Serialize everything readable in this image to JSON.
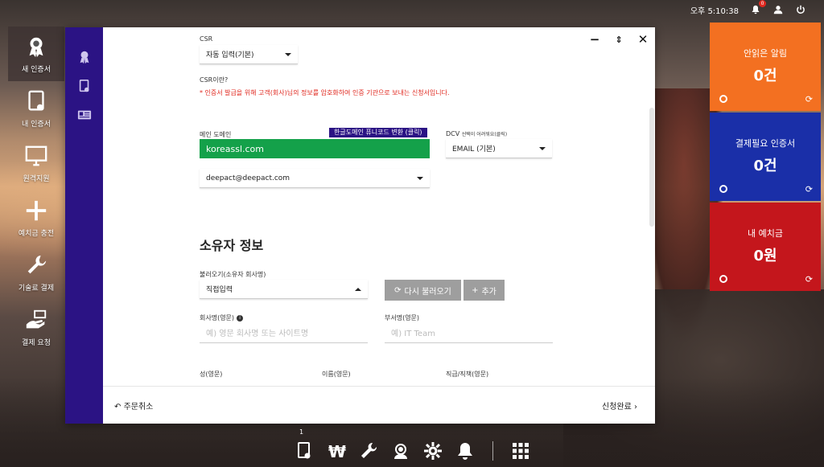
{
  "topbar": {
    "time": "오후 5:10:38",
    "notif_count": "0"
  },
  "desktop": [
    {
      "label": "새 인증서",
      "icon": "award-icon",
      "active": true
    },
    {
      "label": "내 인증서",
      "icon": "certificate-icon"
    },
    {
      "label": "원격지원",
      "icon": "monitor-icon"
    },
    {
      "label": "예치금 충전",
      "icon": "plus-icon"
    },
    {
      "label": "기술료 결제",
      "icon": "wrench-icon"
    },
    {
      "label": "결제 요청",
      "icon": "payment-icon"
    }
  ],
  "form": {
    "csr_label": "CSR",
    "csr_select": "자동 입력(기본)",
    "csr_what": "CSR이란?",
    "csr_note": "* 인증서 발급을 위해 고객(회사)님의 정보를 암호화하여 인증 기관으로 보내는 신청서입니다.",
    "main_domain_label": "메인 도메인",
    "punycode_btn": "한글도메인 퓨니코드 변환 (클릭)",
    "domain_value": "koreassl.com",
    "dcv_label": "DCV",
    "dcv_hint": "선택이 어려워요(클릭)",
    "dcv_select": "EMAIL (기본)",
    "email_select": "deepact@deepact.com",
    "owner_title": "소유자 정보",
    "load_label": "불러오기(소유자 회사명)",
    "load_select": "직접입력",
    "reload_btn": "다시 불러오기",
    "add_btn": "추가",
    "company_label": "회사명(영문)",
    "company_placeholder": "예) 영문 회사명 또는 사이트명",
    "dept_label": "부서명(영문)",
    "dept_placeholder": "예) IT Team",
    "last_name_label": "성(영문)",
    "first_name_label": "이름(영문)",
    "title_label": "직급/직책(영문)"
  },
  "footer": {
    "cancel": "주문취소",
    "submit": "신청완료"
  },
  "tiles": [
    {
      "title": "안읽은 알림",
      "value": "0건",
      "color": "#f37021"
    },
    {
      "title": "결제필요 인증서",
      "value": "0건",
      "color": "#1a2fa8"
    },
    {
      "title": "내 예치금",
      "value": "0원",
      "color": "#c4161c"
    }
  ],
  "taskbar": {
    "count": "1"
  }
}
